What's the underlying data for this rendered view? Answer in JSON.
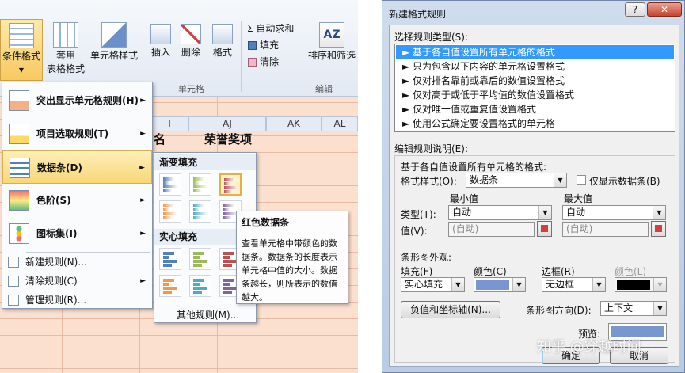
{
  "ribbon": {
    "cond_format": "条件格式",
    "table_format": [
      "套用",
      "表格格式"
    ],
    "cell_style": "单元格样式",
    "insert": "插入",
    "delete": "删除",
    "format": "格式",
    "autosum": "Σ 自动求和",
    "fill": "填充",
    "clear": "清除",
    "sort_filter": "排序和筛选",
    "group_cells": "单元格",
    "group_edit": "编辑"
  },
  "sheet": {
    "columns": [
      "I",
      "AJ",
      "AK",
      "AL"
    ],
    "cells": [
      "名",
      "荣誉奖项"
    ]
  },
  "menu": {
    "items": [
      {
        "label": "突出显示单元格规则(H)",
        "icon": "highlight-rules-icon"
      },
      {
        "label": "项目选取规则(T)",
        "icon": "top-bottom-rules-icon"
      },
      {
        "label": "数据条(D)",
        "icon": "data-bars-icon"
      },
      {
        "label": "色阶(S)",
        "icon": "color-scales-icon"
      },
      {
        "label": "图标集(I)",
        "icon": "icon-sets-icon"
      }
    ],
    "small": [
      "新建规则(N)...",
      "清除规则(C)",
      "管理规则(R)..."
    ]
  },
  "submenu": {
    "gradient": "渐变填充",
    "solid": "实心填充",
    "other": "其他规则(M)...",
    "colors": [
      "#4f81bd",
      "#9bbb59",
      "#c0504d",
      "#f79646",
      "#4bacc6",
      "#8064a2"
    ]
  },
  "tooltip": {
    "title": "红色数据条",
    "body": "查看单元格中带颜色的数据条。数据条的长度表示单元格中值的大小。数据条越长，则所表示的数值越大。"
  },
  "dialog": {
    "title": "新建格式规则",
    "help": "?",
    "close": "✕",
    "select_type_label": "选择规则类型(S):",
    "rule_types": [
      "► 基于各自值设置所有单元格的格式",
      "► 只为包含以下内容的单元格设置格式",
      "► 仅对排名靠前或靠后的数值设置格式",
      "► 仅对高于或低于平均值的数值设置格式",
      "► 仅对唯一值或重复值设置格式",
      "► 使用公式确定要设置格式的单元格"
    ],
    "edit_label": "编辑规则说明(E):",
    "based_label": "基于各自值设置所有单元格的格式:",
    "format_style_label": "格式样式(O):",
    "format_style_value": "数据条",
    "show_bar_only": "仅显示数据条(B)",
    "min_label": "最小值",
    "max_label": "最大值",
    "type_label": "类型(T):",
    "value_label": "值(V):",
    "min_type": "自动",
    "max_type": "自动",
    "min_value": "(自动)",
    "max_value": "(自动)",
    "bar_appearance": "条形图外观:",
    "fill_label": "填充(F)",
    "color_label": "颜色(C)",
    "border_label": "边框(R)",
    "color2_label": "颜色(L)",
    "fill_value": "实心填充",
    "border_value": "无边框",
    "fill_color": "#7896cf",
    "border_color": "#000000",
    "neg_axis_button": "负值和坐标轴(N)...",
    "direction_label": "条形图方向(D):",
    "direction_value": "上下文",
    "preview_label": "预览:",
    "ok": "确定",
    "cancel": "取消"
  },
  "watermark": "知乎 @穿越时间"
}
